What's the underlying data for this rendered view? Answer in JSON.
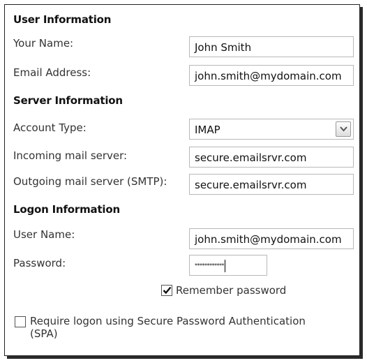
{
  "user_info": {
    "heading": "User Information",
    "your_name_label": "Your Name:",
    "your_name_value": "John Smith",
    "email_label": "Email Address:",
    "email_value": "john.smith@mydomain.com"
  },
  "server_info": {
    "heading": "Server Information",
    "account_type_label": "Account Type:",
    "account_type_value": "IMAP",
    "incoming_label": "Incoming mail server:",
    "incoming_value": "secure.emailsrvr.com",
    "outgoing_label": "Outgoing mail server (SMTP):",
    "outgoing_value": "secure.emailsrvr.com"
  },
  "logon_info": {
    "heading": "Logon Information",
    "user_name_label": "User Name:",
    "user_name_value": "john.smith@mydomain.com",
    "password_label": "Password:",
    "password_value": "************",
    "remember_label": "Remember password",
    "remember_checked": true,
    "spa_label_line1": "Require logon using Secure Password Authentication",
    "spa_label_line2": "(SPA)",
    "spa_checked": false
  },
  "icons": {
    "dropdown": "chevron-down-icon",
    "check": "checkmark-icon"
  }
}
